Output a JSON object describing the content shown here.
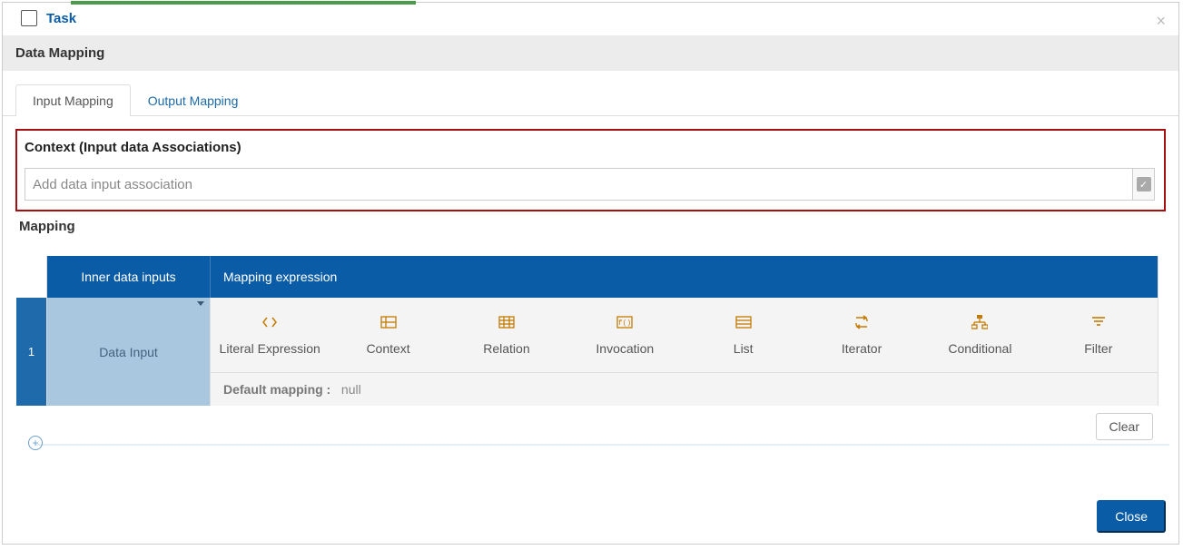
{
  "header": {
    "title": "Task"
  },
  "section": {
    "title": "Data Mapping"
  },
  "tabs": {
    "input": "Input Mapping",
    "output": "Output Mapping"
  },
  "context": {
    "label": "Context (Input data Associations)",
    "placeholder": "Add data input association"
  },
  "mapping": {
    "label": "Mapping",
    "col1": "Inner data inputs",
    "col2": "Mapping expression",
    "row_number": "1",
    "data_input_label": "Data Input",
    "default_label": "Default mapping :",
    "default_value": "null",
    "options": [
      "Literal Expression",
      "Context",
      "Relation",
      "Invocation",
      "List",
      "Iterator",
      "Conditional",
      "Filter"
    ]
  },
  "buttons": {
    "clear": "Clear",
    "close": "Close"
  }
}
